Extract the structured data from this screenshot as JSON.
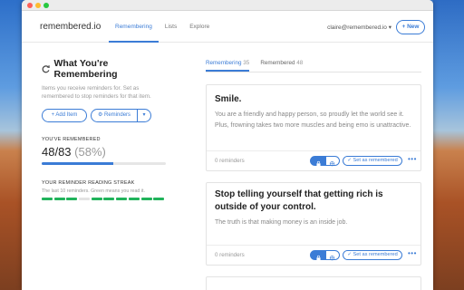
{
  "window": {
    "brand": "remembered.io",
    "nav": [
      "Remembering",
      "Lists",
      "Explore"
    ],
    "account": "claire@remembered.io ▾",
    "new_button": "+ New"
  },
  "left": {
    "heading": "What You're Remembering",
    "subtext": "Items you receive reminders for. Set as remembered to stop reminders for that item.",
    "add_button": "+ Add Item",
    "reminders_button": "⚙ Reminders",
    "caret": "▾",
    "youve_label": "YOU'VE REMEMBERED",
    "count": "48/83",
    "percent": "(58%)",
    "progress": 0.58,
    "streak_label": "YOUR REMINDER READING STREAK",
    "streak_sub": "The last 10 reminders. Green means you read it.",
    "streak": [
      1,
      1,
      1,
      0,
      1,
      1,
      1,
      1,
      1,
      1
    ]
  },
  "tabs": [
    {
      "label": "Remembering",
      "count": "35"
    },
    {
      "label": "Remembered",
      "count": "48"
    }
  ],
  "cards": [
    {
      "title": "Smile.",
      "body": "You are a friendly and happy person, so proudly let the world see it. Plus, frowning takes two more muscles and being emo is unattractive.",
      "reminders": "0 reminders",
      "set_label": "✓ Set as remembered",
      "more": "•••"
    },
    {
      "title": "Stop telling yourself that getting rich is outside of your control.",
      "body": "The truth is that making money is an inside job.",
      "reminders": "0 reminders",
      "set_label": "✓ Set as remembered",
      "more": "•••"
    }
  ],
  "colors": {
    "accent": "#3b7cd6",
    "streak_on": "#21b35b",
    "streak_off": "#e3e3e3"
  }
}
